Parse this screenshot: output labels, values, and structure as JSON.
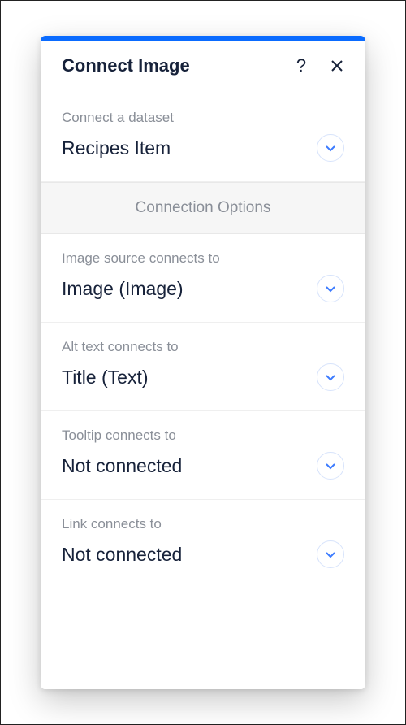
{
  "header": {
    "title": "Connect Image"
  },
  "dataset": {
    "label": "Connect a dataset",
    "value": "Recipes Item"
  },
  "group_header": "Connection Options",
  "fields": [
    {
      "label": "Image source connects to",
      "value": "Image (Image)"
    },
    {
      "label": "Alt text connects to",
      "value": "Title (Text)"
    },
    {
      "label": "Tooltip connects to",
      "value": "Not connected"
    },
    {
      "label": "Link connects to",
      "value": "Not connected"
    }
  ]
}
